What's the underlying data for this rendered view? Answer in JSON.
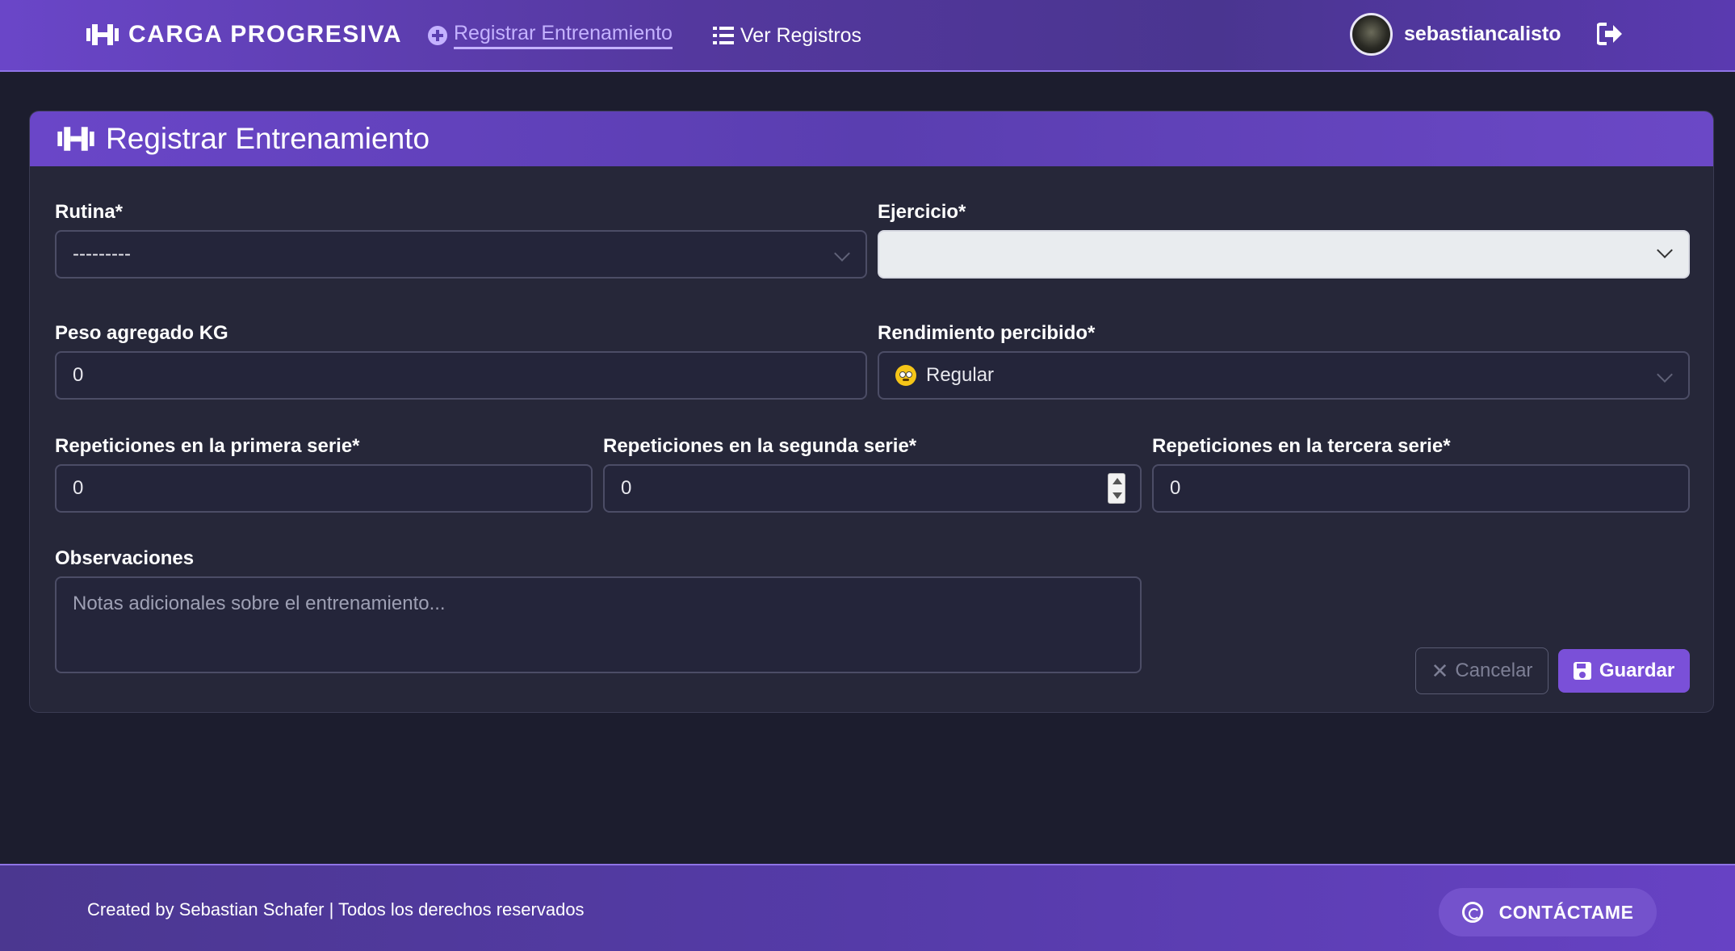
{
  "nav": {
    "brand": "CARGA PROGRESIVA",
    "links": [
      {
        "label": "Registrar Entrenamiento",
        "active": true
      },
      {
        "label": "Ver Registros",
        "active": false
      }
    ],
    "username": "sebastiancalisto"
  },
  "form": {
    "title": "Registrar Entrenamiento",
    "fields": {
      "rutina": {
        "label": "Rutina*",
        "value": "---------"
      },
      "ejercicio": {
        "label": "Ejercicio*",
        "value": ""
      },
      "peso": {
        "label": "Peso agregado KG",
        "value": "0"
      },
      "rendimiento": {
        "label": "Rendimiento percibido*",
        "value": "Regular"
      },
      "rep1": {
        "label": "Repeticiones en la primera serie*",
        "value": "0"
      },
      "rep2": {
        "label": "Repeticiones en la segunda serie*",
        "value": "0"
      },
      "rep3": {
        "label": "Repeticiones en la tercera serie*",
        "value": "0"
      },
      "observaciones": {
        "label": "Observaciones",
        "placeholder": "Notas adicionales sobre el entrenamiento..."
      }
    },
    "buttons": {
      "cancel": "Cancelar",
      "save": "Guardar"
    }
  },
  "footer": {
    "text": "Created by Sebastian Schafer | Todos los derechos reservados",
    "contact": "CONTÁCTAME"
  },
  "colors": {
    "accent": "#7a50d8",
    "background": "#1c1d2e",
    "card": "#262739"
  }
}
